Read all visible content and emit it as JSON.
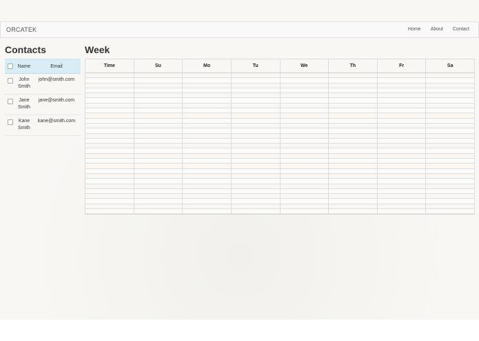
{
  "navbar": {
    "brand": "ORCATEK",
    "items": [
      {
        "label": "Home",
        "name": "nav-home"
      },
      {
        "label": "About",
        "name": "nav-about"
      },
      {
        "label": "Contact",
        "name": "nav-contact"
      }
    ]
  },
  "contacts": {
    "title": "Contacts",
    "headers": {
      "name": "Name",
      "email": "Email"
    },
    "rows": [
      {
        "name": "John Smith",
        "email": "john@smith.com"
      },
      {
        "name": "Jane Smith",
        "email": "jane@smith.com"
      },
      {
        "name": "Kane Smith",
        "email": "kane@smith.com"
      }
    ]
  },
  "week": {
    "title": "Week",
    "headers": [
      "Time",
      "Su",
      "Mo",
      "Tu",
      "We",
      "Th",
      "Fr",
      "Sa"
    ],
    "row_count": 28
  }
}
